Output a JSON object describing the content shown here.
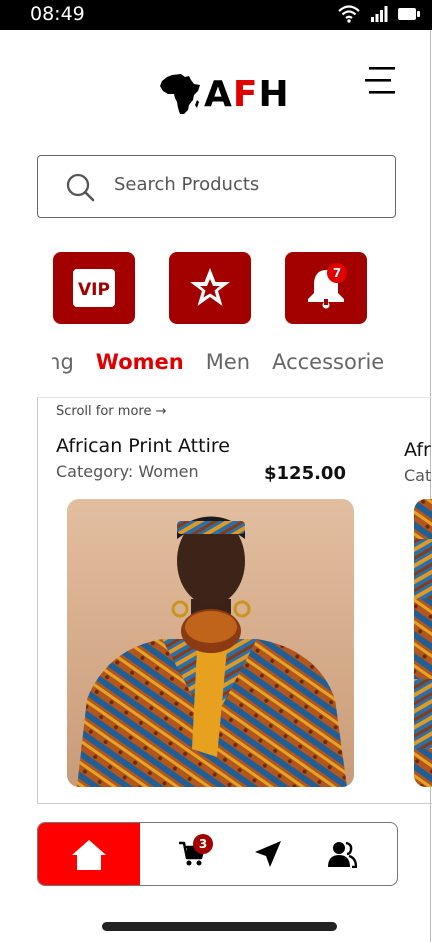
{
  "status_bar": {
    "time": "08:49",
    "icons": [
      "wifi-icon",
      "signal-icon",
      "battery-icon"
    ]
  },
  "header": {
    "logo_text_prefix": "A",
    "logo_text_red": "F",
    "logo_text_suffix": "H",
    "logo_icon": "africa-map-icon",
    "menu_icon": "menu-icon"
  },
  "search": {
    "placeholder": "Search Products",
    "icon": "search-icon"
  },
  "quick_actions": [
    {
      "name": "vip-button",
      "icon": "vip-icon",
      "label": "VIP"
    },
    {
      "name": "favorites-button",
      "icon": "star-icon"
    },
    {
      "name": "notifications-button",
      "icon": "bell-icon",
      "badge": "7"
    }
  ],
  "category_tabs": {
    "items": [
      "hing",
      "Women",
      "Men",
      "Accessorie"
    ],
    "active": "Women"
  },
  "products": {
    "scroll_hint": "Scroll for more →",
    "items": [
      {
        "title": "African Print Attire",
        "category": "Category: Women",
        "price": "$125.00"
      },
      {
        "title": "Afri",
        "category": "Cate"
      }
    ]
  },
  "bottom_nav": {
    "items": [
      "home-icon",
      "cart-icon",
      "send-icon",
      "users-icon"
    ],
    "cart_badge": "3",
    "active": "home-icon"
  },
  "colors": {
    "brand_red": "#a30000",
    "accent_red": "#ff0000",
    "text_red": "#e00000"
  }
}
